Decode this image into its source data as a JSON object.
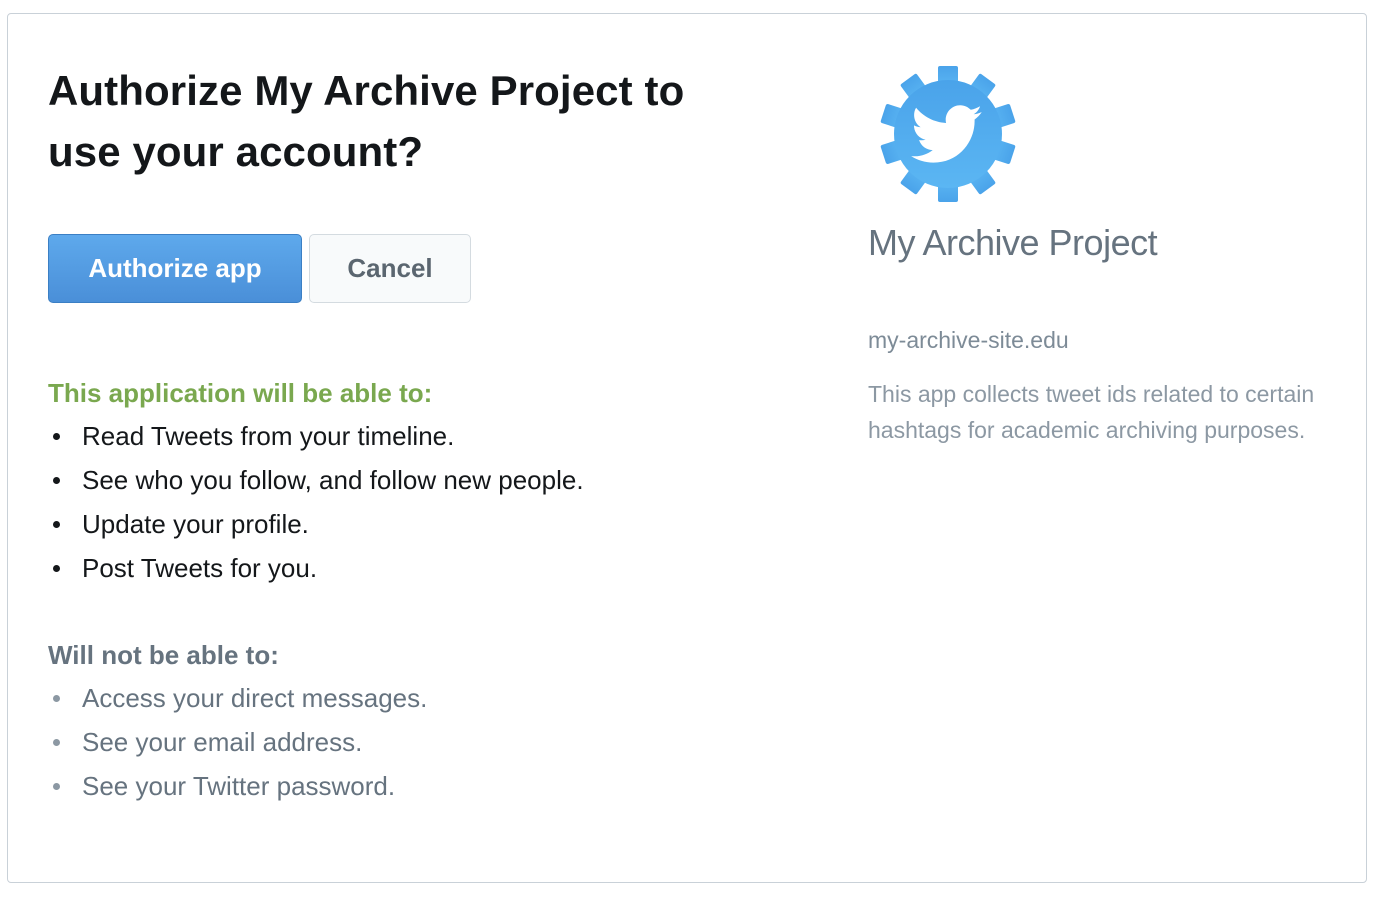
{
  "page": {
    "title_line1": "Authorize My Archive Project to",
    "title_line2": "use your account?"
  },
  "buttons": {
    "authorize_label": "Authorize app",
    "cancel_label": "Cancel"
  },
  "permissions": {
    "can_heading": "This application will be able to:",
    "can_items": [
      "Read Tweets from your timeline.",
      "See who you follow, and follow new people.",
      "Update your profile.",
      "Post Tweets for you."
    ],
    "cannot_heading": "Will not be able to:",
    "cannot_items": [
      "Access your direct messages.",
      "See your email address.",
      "See your Twitter password."
    ]
  },
  "app": {
    "name": "My Archive Project",
    "url": "my-archive-site.edu",
    "description": "This app collects tweet ids related to certain hashtags for academic archiving purposes.",
    "logo_icon": "twitter-gear-icon"
  },
  "colors": {
    "primary_button": "#4a8fd8",
    "can_heading": "#7aa84f",
    "logo_blue": "#55acee",
    "muted_text": "#66737f"
  }
}
